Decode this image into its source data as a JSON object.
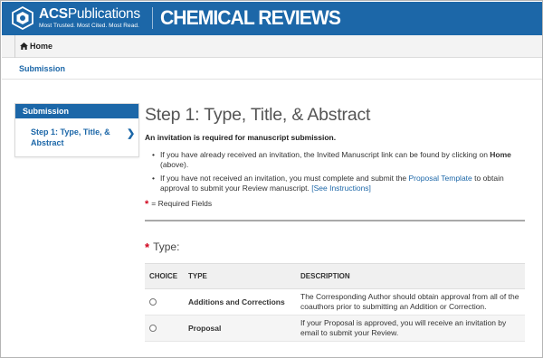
{
  "header": {
    "acs_brand_bold": "ACS",
    "acs_brand_rest": "Publications",
    "acs_tagline": "Most Trusted. Most Cited. Most Read.",
    "journal_title": "CHEMICAL REVIEWS",
    "colors": {
      "brand_blue": "#1c67a8"
    }
  },
  "breadcrumb": {
    "home_label": "Home",
    "home_icon": "home-icon"
  },
  "subbar": {
    "label": "Submission"
  },
  "sidebar": {
    "heading": "Submission",
    "items": [
      {
        "label": "Step 1: Type, Title, & Abstract",
        "icon": "chevron-right-icon"
      }
    ]
  },
  "main": {
    "title": "Step 1: Type, Title, & Abstract",
    "invite_heading": "An invitation is required for manuscript submission.",
    "bullet1": {
      "pre": "If you have already received an invitation, the Invited Manuscript link can be found by clicking on ",
      "bold": "Home",
      "post": " (above)."
    },
    "bullet2": {
      "pre": "If you have not received an invitation, you must complete and submit the ",
      "link": "Proposal Template",
      "mid": " to obtain approval to submit your Review manuscript. ",
      "instructions_link": "[See Instructions]"
    },
    "required_marker": "*",
    "required_note": "= Required Fields",
    "type_label": "Type:"
  },
  "type_table": {
    "headers": [
      "CHOICE",
      "TYPE",
      "DESCRIPTION"
    ],
    "rows": [
      {
        "type": "Additions and Corrections",
        "description": "The Corresponding Author should obtain approval from all of the coauthors prior to submitting an Addition or Correction."
      },
      {
        "type": "Proposal",
        "description": "If your Proposal is approved, you will receive an invitation by email to submit your Review."
      }
    ]
  }
}
